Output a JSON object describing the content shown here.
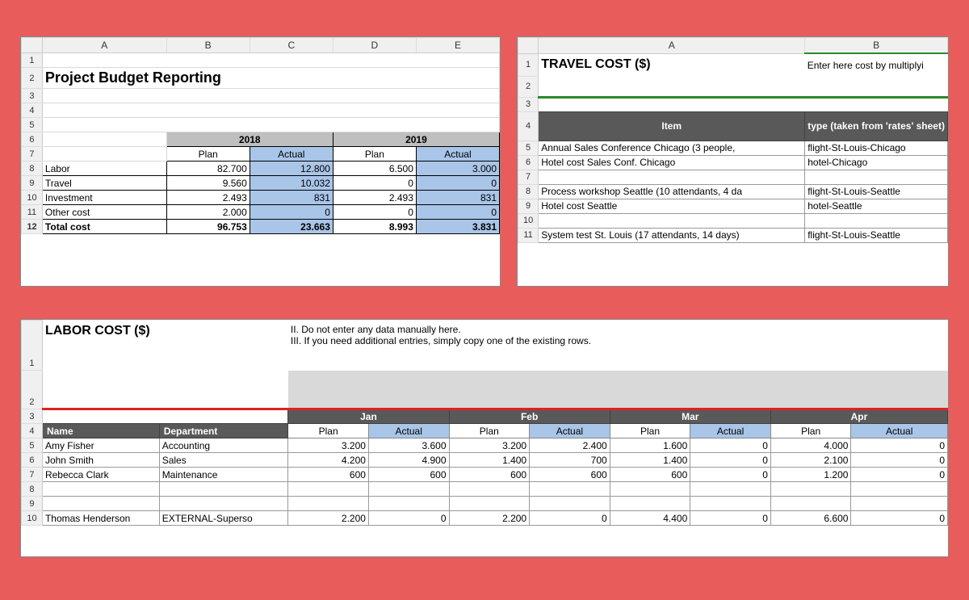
{
  "budget": {
    "title": "Project Budget Reporting",
    "cols": [
      "A",
      "B",
      "C",
      "D",
      "E"
    ],
    "years": {
      "y1": "2018",
      "y2": "2019"
    },
    "headers": {
      "plan": "Plan",
      "actual": "Actual"
    },
    "rows": [
      {
        "label": "Labor",
        "p1": "82.700",
        "a1": "12.800",
        "p2": "6.500",
        "a2": "3.000"
      },
      {
        "label": "Travel",
        "p1": "9.560",
        "a1": "10.032",
        "p2": "0",
        "a2": "0"
      },
      {
        "label": "Investment",
        "p1": "2.493",
        "a1": "831",
        "p2": "2.493",
        "a2": "831"
      },
      {
        "label": "Other cost",
        "p1": "2.000",
        "a1": "0",
        "p2": "0",
        "a2": "0"
      }
    ],
    "total": {
      "label": "Total cost",
      "p1": "96.753",
      "a1": "23.663",
      "p2": "8.993",
      "a2": "3.831"
    }
  },
  "travel": {
    "cols": [
      "A",
      "B"
    ],
    "title": "TRAVEL COST ($)",
    "hint": "Enter here cost by multiplyi",
    "hdr_item": "Item",
    "hdr_type": "type (taken from 'rates' sheet)",
    "rows": [
      {
        "n": "5",
        "item": "Annual Sales Conference Chicago (3 people,",
        "type": "flight-St-Louis-Chicago"
      },
      {
        "n": "6",
        "item": "Hotel cost Sales Conf. Chicago",
        "type": "hotel-Chicago"
      },
      {
        "n": "7",
        "item": "",
        "type": ""
      },
      {
        "n": "8",
        "item": "Process workshop Seattle (10 attendants, 4 da",
        "type": "flight-St-Louis-Seattle"
      },
      {
        "n": "9",
        "item": "Hotel cost Seattle",
        "type": "hotel-Seattle"
      },
      {
        "n": "10",
        "item": "",
        "type": ""
      },
      {
        "n": "11",
        "item": "System test St. Louis (17 attendants, 14 days)",
        "type": "flight-St-Louis-Seattle"
      }
    ]
  },
  "labor": {
    "title": "LABOR COST ($)",
    "instructions_1": "II. Do not enter any data manually here.",
    "instructions_2": "III. If you need additional entries, simply copy one of the existing rows.",
    "months": [
      "Jan",
      "Feb",
      "Mar",
      "Apr"
    ],
    "headers": {
      "name": "Name",
      "dept": "Department",
      "plan": "Plan",
      "actual": "Actual"
    },
    "rows": [
      {
        "n": "5",
        "name": "Amy Fisher",
        "dept": "Accounting",
        "v": [
          "3.200",
          "3.600",
          "3.200",
          "2.400",
          "1.600",
          "0",
          "4.000",
          "0"
        ]
      },
      {
        "n": "6",
        "name": "John Smith",
        "dept": "Sales",
        "v": [
          "4.200",
          "4.900",
          "1.400",
          "700",
          "1.400",
          "0",
          "2.100",
          "0"
        ]
      },
      {
        "n": "7",
        "name": "Rebecca Clark",
        "dept": "Maintenance",
        "v": [
          "600",
          "600",
          "600",
          "600",
          "600",
          "0",
          "1.200",
          "0"
        ]
      },
      {
        "n": "8",
        "name": "",
        "dept": "",
        "v": [
          "",
          "",
          "",
          "",
          "",
          "",
          "",
          ""
        ]
      },
      {
        "n": "9",
        "name": "",
        "dept": "",
        "v": [
          "",
          "",
          "",
          "",
          "",
          "",
          "",
          ""
        ]
      },
      {
        "n": "10",
        "name": "Thomas Henderson",
        "dept": "EXTERNAL-Superso",
        "v": [
          "2.200",
          "0",
          "2.200",
          "0",
          "4.400",
          "0",
          "6.600",
          "0"
        ]
      }
    ]
  }
}
